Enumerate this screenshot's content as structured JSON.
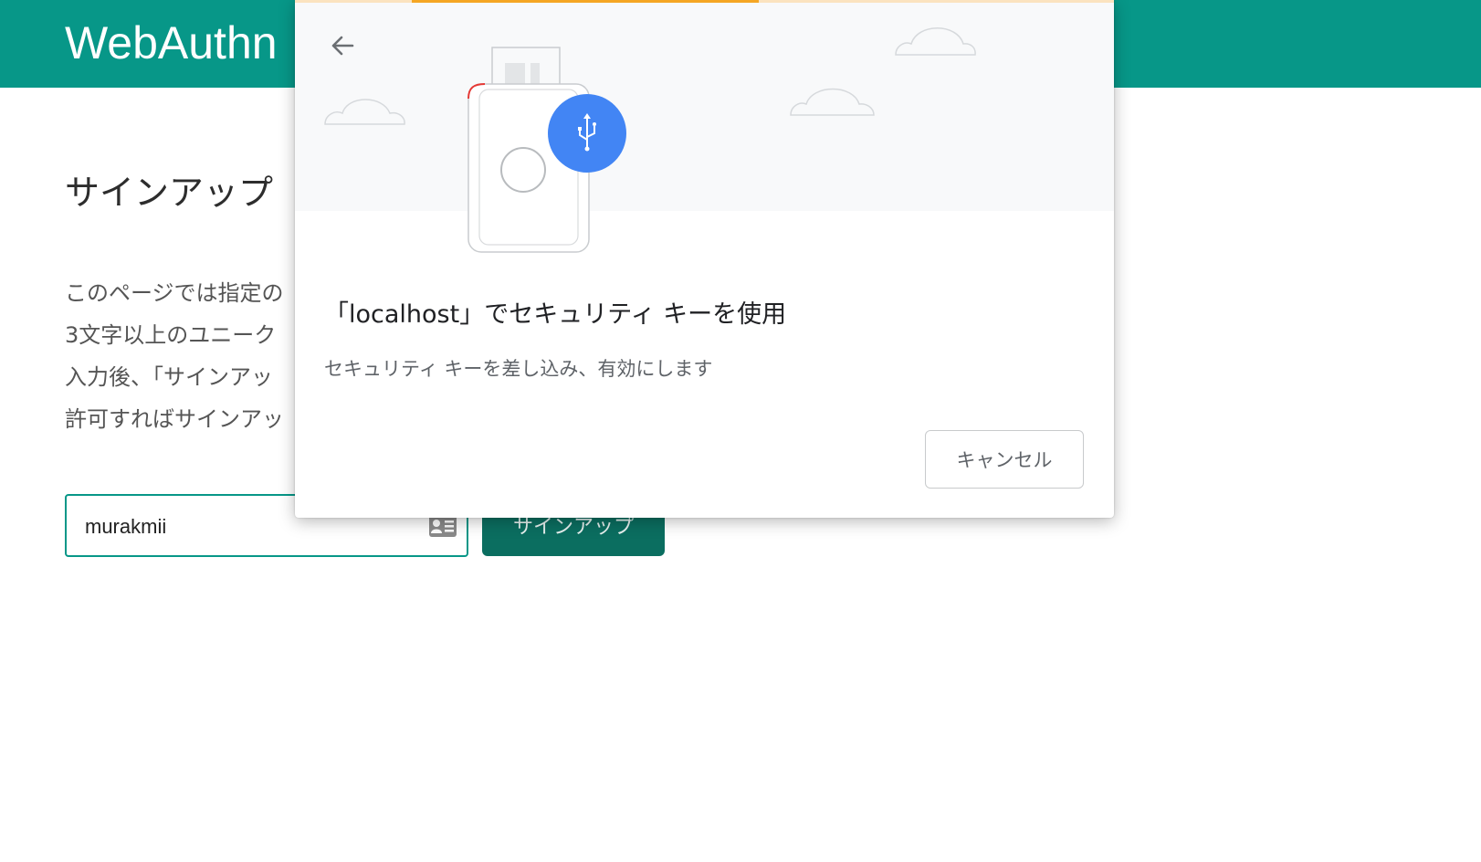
{
  "header": {
    "app_title": "WebAuthn"
  },
  "main": {
    "heading": "サインアップ",
    "description_lines": [
      "このページでは指定の",
      "3文字以上のユニーク",
      "入力後、「サインアッ",
      "許可すればサインアッ"
    ],
    "username_value": "murakmii",
    "signup_label": "サインアップ"
  },
  "dialog": {
    "title": "「localhost」でセキュリティ キーを使用",
    "subtitle": "セキュリティ キーを差し込み、有効にします",
    "cancel_label": "キャンセル"
  },
  "icons": {
    "back": "arrow-back-icon",
    "usb": "usb-icon",
    "security_key": "security-key-illustration",
    "contact_card": "contact-card-icon",
    "cloud": "cloud-icon"
  },
  "colors": {
    "header_bg": "#079788",
    "signup_button": "#0b6e60",
    "input_border": "#079788",
    "usb_badge": "#4285f4",
    "progress": "#f5a623"
  }
}
